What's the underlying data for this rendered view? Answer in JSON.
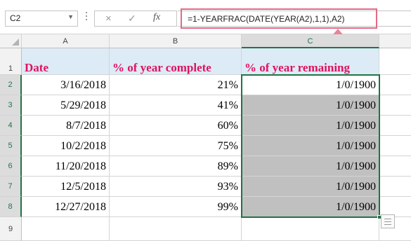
{
  "formula_bar": {
    "name_box": "C2",
    "cancel_icon": "×",
    "enter_icon": "✓",
    "fx_label": "fx",
    "formula": "=1-YEARFRAC(DATE(YEAR(A2),1,1),A2)"
  },
  "columns": [
    "A",
    "B",
    "C"
  ],
  "rows": [
    "1",
    "2",
    "3",
    "4",
    "5",
    "6",
    "7",
    "8",
    "9"
  ],
  "headers": {
    "a": "Date",
    "b": "% of year complete",
    "c": "% of year remaining"
  },
  "data": [
    {
      "date": "3/16/2018",
      "pct": "21%",
      "rem": "1/0/1900"
    },
    {
      "date": "5/29/2018",
      "pct": "41%",
      "rem": "1/0/1900"
    },
    {
      "date": "8/7/2018",
      "pct": "60%",
      "rem": "1/0/1900"
    },
    {
      "date": "10/2/2018",
      "pct": "75%",
      "rem": "1/0/1900"
    },
    {
      "date": "11/20/2018",
      "pct": "89%",
      "rem": "1/0/1900"
    },
    {
      "date": "12/5/2018",
      "pct": "93%",
      "rem": "1/0/1900"
    },
    {
      "date": "12/27/2018",
      "pct": "99%",
      "rem": "1/0/1900"
    }
  ],
  "colors": {
    "header_fill": "#ddebf7",
    "header_text": "#e0115f",
    "selection": "#217346",
    "fill_gray": "#c0c0c0",
    "highlight": "#e36a85"
  }
}
